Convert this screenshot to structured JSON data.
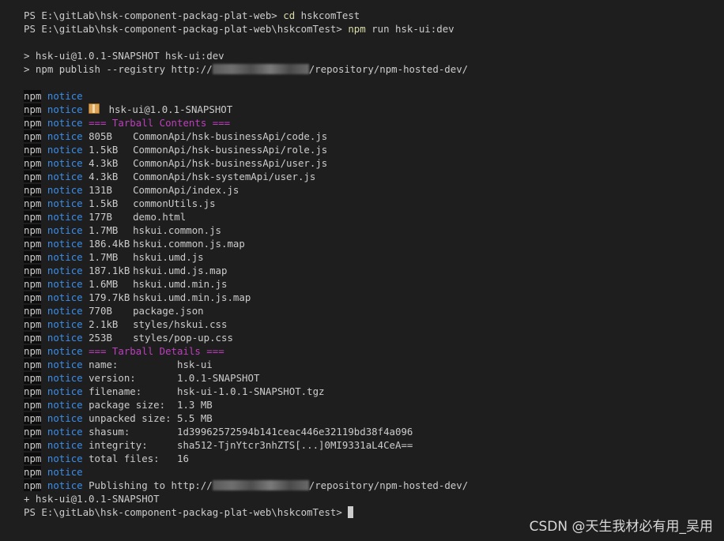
{
  "terminal": {
    "prompt_1": "PS E:\\gitLab\\hsk-component-packag-plat-web>",
    "cmd_1_name": "cd",
    "cmd_1_args": "hskcomTest",
    "prompt_2": "PS E:\\gitLab\\hsk-component-packag-plat-web\\hskcomTest>",
    "cmd_2_name": "npm",
    "cmd_2_args": "run hsk-ui:dev",
    "script_1": "> hsk-ui@1.0.1-SNAPSHOT hsk-ui:dev",
    "script_2_prefix": "> npm publish --registry http://",
    "script_2_suffix": "/repository/npm-hosted-dev/",
    "npm_label": "npm",
    "notice_label": "notice",
    "package_id": "hsk-ui@1.0.1-SNAPSHOT",
    "tarball_contents_header": "=== Tarball Contents ===",
    "files": [
      {
        "size": "805B",
        "path": "CommonApi/hsk-businessApi/code.js"
      },
      {
        "size": "1.5kB",
        "path": "CommonApi/hsk-businessApi/role.js"
      },
      {
        "size": "4.3kB",
        "path": "CommonApi/hsk-businessApi/user.js"
      },
      {
        "size": "4.3kB",
        "path": "CommonApi/hsk-systemApi/user.js"
      },
      {
        "size": "131B",
        "path": "CommonApi/index.js"
      },
      {
        "size": "1.5kB",
        "path": "commonUtils.js"
      },
      {
        "size": "177B",
        "path": "demo.html"
      },
      {
        "size": "1.7MB",
        "path": "hskui.common.js"
      },
      {
        "size": "186.4kB",
        "path": "hskui.common.js.map"
      },
      {
        "size": "1.7MB",
        "path": "hskui.umd.js"
      },
      {
        "size": "187.1kB",
        "path": "hskui.umd.js.map"
      },
      {
        "size": "1.6MB",
        "path": "hskui.umd.min.js"
      },
      {
        "size": "179.7kB",
        "path": "hskui.umd.min.js.map"
      },
      {
        "size": "770B",
        "path": "package.json"
      },
      {
        "size": "2.1kB",
        "path": "styles/hskui.css"
      },
      {
        "size": "253B",
        "path": "styles/pop-up.css"
      }
    ],
    "tarball_details_header": "=== Tarball Details ===",
    "details": [
      {
        "label": "name:          ",
        "value": "hsk-ui"
      },
      {
        "label": "version:       ",
        "value": "1.0.1-SNAPSHOT"
      },
      {
        "label": "filename:      ",
        "value": "hsk-ui-1.0.1-SNAPSHOT.tgz"
      },
      {
        "label": "package size:  ",
        "value": "1.3 MB"
      },
      {
        "label": "unpacked size: ",
        "value": "5.5 MB"
      },
      {
        "label": "shasum:        ",
        "value": "1d39962572594b141ceac446e32119bd38f4a096"
      },
      {
        "label": "integrity:     ",
        "value": "sha512-TjnYtcr3nhZTS[...]0MI9331aL4CeA=="
      },
      {
        "label": "total files:   ",
        "value": "16"
      }
    ],
    "publishing_prefix": "Publishing to http://",
    "publishing_suffix": "/repository/npm-hosted-dev/",
    "published": "+ hsk-ui@1.0.1-SNAPSHOT",
    "prompt_final": "PS E:\\gitLab\\hsk-component-packag-plat-web\\hskcomTest>"
  },
  "watermark": "CSDN @天生我材必有用_吴用",
  "colors": {
    "background": "#1e1e1e",
    "text": "#cccccc",
    "command": "#dcdcaa",
    "notice": "#3b8eea",
    "header": "#bc3fbc"
  }
}
